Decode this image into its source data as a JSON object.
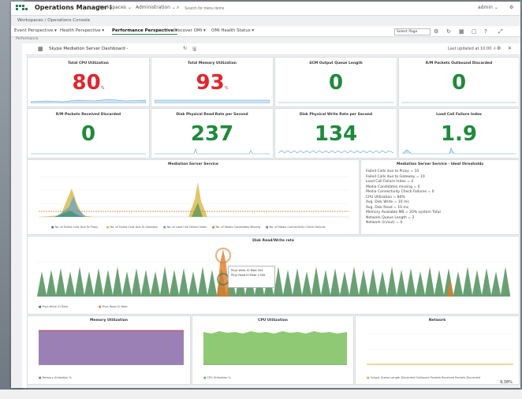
{
  "app": {
    "title": "Operations Manager i"
  },
  "topmenu": [
    {
      "label": "Workspaces ⌄"
    },
    {
      "label": "Administration ⌄"
    }
  ],
  "search": {
    "placeholder": "Search for menu items"
  },
  "user": {
    "label": "admin ⌄"
  },
  "breadcrumb": "Workspaces  /  Operations Console",
  "tabs": [
    {
      "label": "Event Perspective ▾"
    },
    {
      "label": "Health Perspective ▾"
    },
    {
      "label": "Performance Perspective ▾"
    },
    {
      "label": "Discover OMi ▾"
    },
    {
      "label": "OMi Health Status ▾"
    }
  ],
  "select_page": "Select Page",
  "subheader": "Performance",
  "dashboard": {
    "title": "Skype Mediation Server Dashboard - ",
    "updated": "Last updated at 10:00 ☼"
  },
  "kpis": [
    {
      "title": "Total CPU Utilization",
      "value": "80",
      "unit": "%",
      "color": "#e0262e"
    },
    {
      "title": "Total Memory Utilization",
      "value": "93",
      "unit": "%",
      "color": "#e0262e"
    },
    {
      "title": "SCM Output Queue Length",
      "value": "0",
      "unit": "",
      "color": "#1f8a3c"
    },
    {
      "title": "R/M Packets Outbound Discarded",
      "value": "0",
      "unit": "",
      "color": "#1f8a3c"
    },
    {
      "title": "R/M Packets Received Discarded",
      "value": "0",
      "unit": "",
      "color": "#1f8a3c"
    },
    {
      "title": "Disk Physical Read Rate per Second",
      "value": "237",
      "unit": "",
      "color": "#1f8a3c"
    },
    {
      "title": "Disk Physical Write Rate per Second",
      "value": "134",
      "unit": "",
      "color": "#1f8a3c"
    },
    {
      "title": "Load Call Failure Index",
      "value": "1.9",
      "unit": "",
      "color": "#1f8a3c"
    }
  ],
  "mediation_chart": {
    "title": "Mediation Server Service",
    "legend": [
      {
        "label": "No. of Failed Calls Due To Proxy",
        "color": "#2a8a5a"
      },
      {
        "label": "No. of Failed Calls Due To Gateway",
        "color": "#d6b33a"
      },
      {
        "label": "No. of Load Call Failure Index",
        "color": "#5aa0d0"
      },
      {
        "label": "No. of Media Candidates Missing",
        "color": "#e07a2a"
      },
      {
        "label": "No. of Media Connectivity Check Failures",
        "color": "#8a6ab0"
      }
    ]
  },
  "mediation_info": {
    "title": "Mediation Server Service - Ideal thresholds",
    "lines": [
      "Failed Calls due to Proxy = 10",
      "Failed Calls due to Gateway = 10",
      "Load Call Failure Index = 4",
      "Media Candidates missing = 0",
      "Media Connectivity Check Failures = 0",
      "CPU Utilization = 80%",
      "Avg. Disk Write = 10 ms",
      "Avg. Disk Read = 10 ms",
      "Memory Available MB = 20% system Total",
      "Network Queue Length = 2",
      "Network (in/out) = 0"
    ]
  },
  "disk_chart": {
    "title": "Disk Read/Write rate",
    "legend": [
      {
        "label": "Phys Write IO Rate",
        "color": "#2a7a4a"
      },
      {
        "label": "Phys Read IO Rate",
        "color": "#e07a2a"
      }
    ],
    "tooltip": {
      "lines": [
        "Phys Write IO Rate  354",
        "Phys Read IO Rate  1.55K"
      ]
    }
  },
  "bottom_charts": [
    {
      "title": "Memory Utilization",
      "legend": "Memory Utilization %",
      "color": "#8a6aa8"
    },
    {
      "title": "CPU Utilization",
      "legend": "CPU Utilization %",
      "color": "#6ab04a"
    },
    {
      "title": "Network",
      "legend": "Output Queue Length   Discarded Outbound Packets   Received Packets Discarded",
      "color": "#d6b33a"
    }
  ],
  "scale": "9,38%"
}
